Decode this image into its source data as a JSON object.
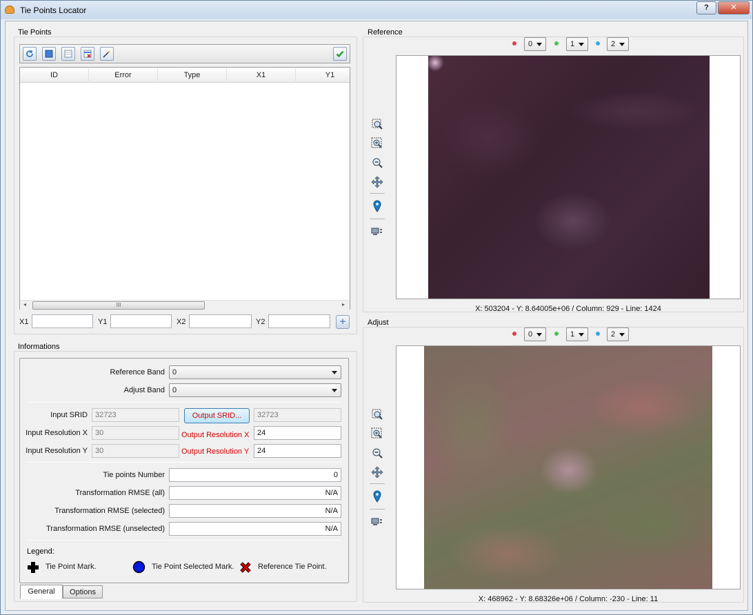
{
  "window": {
    "title": "Tie Points Locator",
    "help_label": "?",
    "close_label": "✕"
  },
  "tie_points": {
    "section_label": "Tie Points",
    "toolbar_icons": [
      "refresh-icon",
      "select-all-icon",
      "unselect-icon",
      "delete-icon",
      "auto-wand-icon",
      "ok-check-icon"
    ],
    "table": {
      "columns": [
        "ID",
        "Error",
        "Type",
        "X1",
        "Y1"
      ],
      "rows": [],
      "scroll_thumb_label": "III",
      "scroll_left": "◂",
      "scroll_right": "▸"
    },
    "coords": {
      "x1_label": "X1",
      "y1_label": "Y1",
      "x2_label": "X2",
      "y2_label": "Y2",
      "x1": "",
      "y1": "",
      "x2": "",
      "y2": "",
      "add_label": "+"
    }
  },
  "informations": {
    "section_label": "Informations",
    "reference_band_label": "Reference Band",
    "reference_band_value": "0",
    "adjust_band_label": "Adjust Band",
    "adjust_band_value": "0",
    "input_srid_label": "Input SRID",
    "input_srid_value": "32723",
    "output_srid_button": "Output SRID...",
    "output_srid_value": "32723",
    "input_res_x_label": "Input Resolution X",
    "input_res_x_value": "30",
    "output_res_x_label": "Output Resolution X",
    "output_res_x_value": "24",
    "input_res_y_label": "Input Resolution Y",
    "input_res_y_value": "30",
    "output_res_y_label": "Output Resolution Y",
    "output_res_y_value": "24",
    "tie_points_number_label": "Tie points Number",
    "tie_points_number_value": "0",
    "rmse_all_label": "Transformation RMSE (all)",
    "rmse_all_value": "N/A",
    "rmse_selected_label": "Transformation RMSE (selected)",
    "rmse_selected_value": "N/A",
    "rmse_unselected_label": "Transformation RMSE (unselected)",
    "rmse_unselected_value": "N/A",
    "legend_label": "Legend:",
    "legend_mark": "Tie Point Mark.",
    "legend_selected": "Tie Point Selected Mark.",
    "legend_reference": "Reference Tie Point.",
    "tabs": [
      "General",
      "Options"
    ]
  },
  "reference": {
    "section_label": "Reference",
    "bands": {
      "red": "0",
      "green": "1",
      "blue": "2"
    },
    "status": "X: 503204 - Y: 8.64005e+06 / Column: 929 - Line: 1424"
  },
  "adjust": {
    "section_label": "Adjust",
    "bands": {
      "red": "0",
      "green": "1",
      "blue": "2"
    },
    "status": "X: 468962 - Y: 8.68326e+06 / Column: -230 - Line: 11"
  },
  "colors": {
    "red_band": "#e0404a",
    "green_band": "#4cc24c",
    "blue_band": "#3aa8e0",
    "accent_red": "#d40000"
  }
}
